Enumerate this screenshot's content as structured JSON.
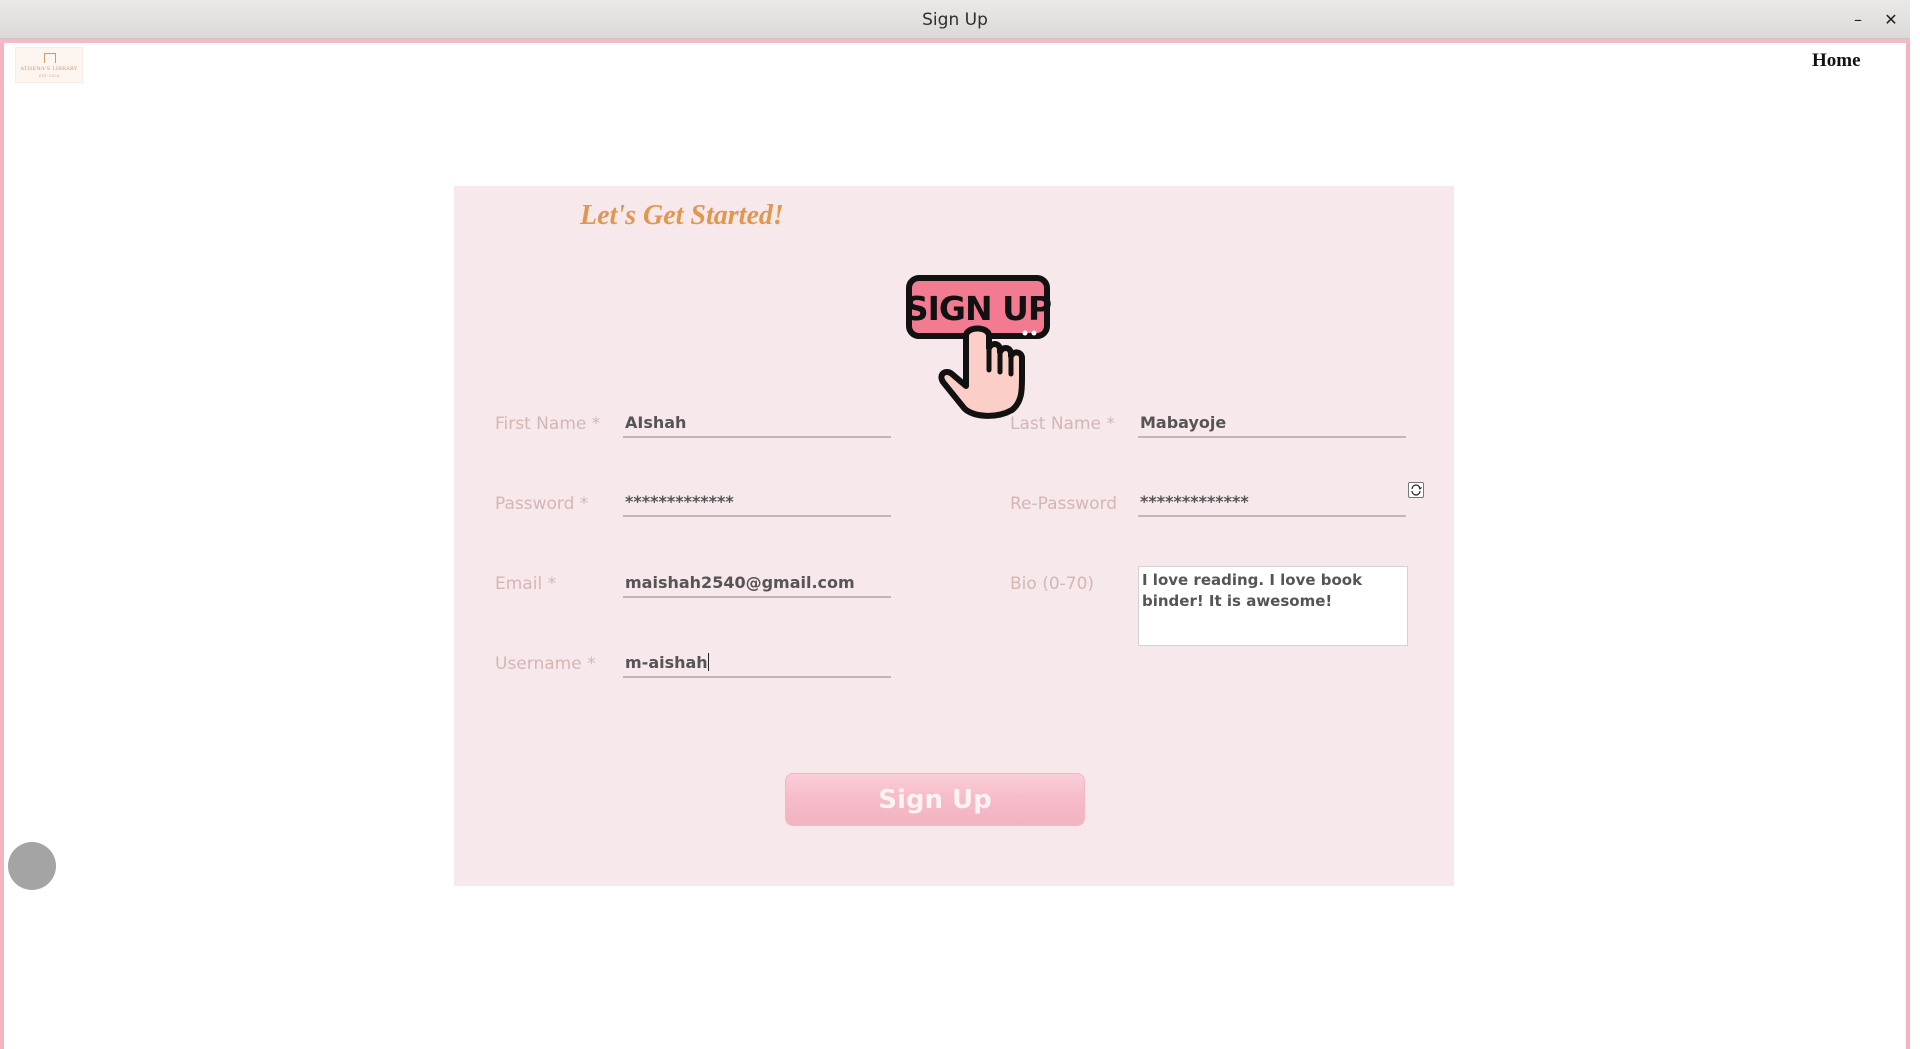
{
  "window": {
    "title": "Sign Up",
    "minimize_glyph": "–",
    "close_glyph": "✕"
  },
  "logo": {
    "text": "ATHENA'S LIBRARY",
    "subtext": "EST. 2024"
  },
  "nav": {
    "home_label": "Home"
  },
  "form": {
    "heading": "Let's Get Started!",
    "illustration_text": "SIGN UP",
    "first_name": {
      "label": "First Name *",
      "value": "AIshah"
    },
    "last_name": {
      "label": "Last Name *",
      "value": "Mabayoje"
    },
    "password": {
      "label": "Password *",
      "value": "*************"
    },
    "re_password": {
      "label": "Re-Password",
      "value": "*************"
    },
    "email": {
      "label": "Email *",
      "value": "maishah2540@gmail.com"
    },
    "bio": {
      "label": "Bio (0-70)",
      "value": "I love reading. I love book binder! It is awesome!"
    },
    "username": {
      "label": "Username *",
      "value": "m-aishah"
    },
    "submit_label": "Sign Up"
  },
  "colors": {
    "accent_pink": "#f7b9c6",
    "card_bg": "#f6e8eb",
    "heading_orange": "#e0974e",
    "label_color": "#d4b7b3"
  },
  "icons": {
    "password_toggle": "refresh-eye-icon",
    "illustration": "sign-up-hand-icon"
  }
}
